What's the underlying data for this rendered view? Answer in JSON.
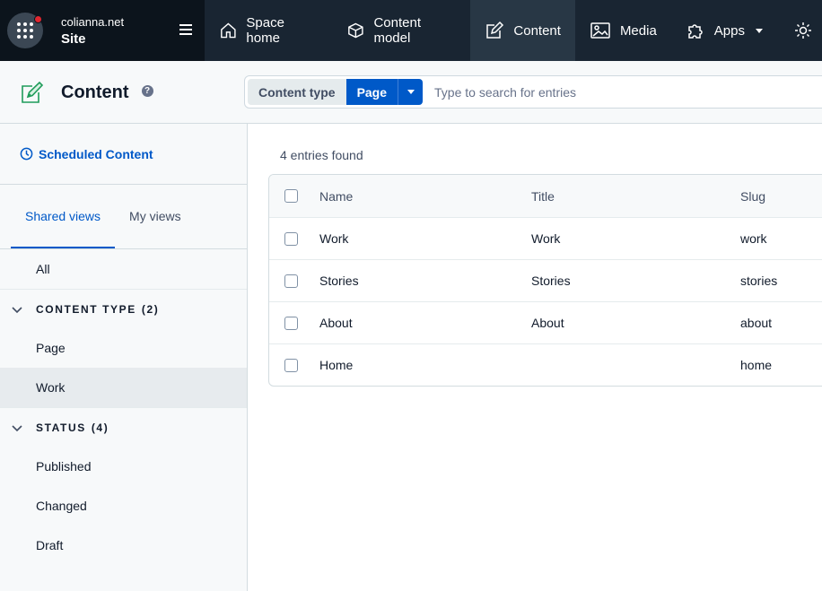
{
  "org": {
    "name": "colianna.net",
    "space": "Site"
  },
  "nav": {
    "items": [
      {
        "label": "Space home",
        "icon": "home-icon"
      },
      {
        "label": "Content model",
        "icon": "cube-icon"
      },
      {
        "label": "Content",
        "icon": "edit-icon",
        "active": true
      },
      {
        "label": "Media",
        "icon": "image-icon"
      },
      {
        "label": "Apps",
        "icon": "puzzle-icon"
      }
    ]
  },
  "header": {
    "title": "Content"
  },
  "search": {
    "filter_label": "Content type",
    "filter_value": "Page",
    "placeholder": "Type to search for entries",
    "value": ""
  },
  "sidebar": {
    "scheduled": "Scheduled Content",
    "tabs": [
      "Shared views",
      "My views"
    ],
    "all": "All",
    "groups": [
      {
        "label": "CONTENT TYPE",
        "count": "(2)",
        "items": [
          "Page",
          "Work"
        ]
      },
      {
        "label": "STATUS",
        "count": "(4)",
        "items": [
          "Published",
          "Changed",
          "Draft"
        ]
      }
    ]
  },
  "main": {
    "count_text": "4 entries found",
    "columns": [
      "Name",
      "Title",
      "Slug"
    ],
    "rows": [
      {
        "name": "Work",
        "title": "Work",
        "slug": "work"
      },
      {
        "name": "Stories",
        "title": "Stories",
        "slug": "stories"
      },
      {
        "name": "About",
        "title": "About",
        "slug": "about"
      },
      {
        "name": "Home",
        "title": "",
        "slug": "home"
      }
    ]
  },
  "colors": {
    "nav_bg": "#192532",
    "org_bg": "#0c141c",
    "accent": "#0059c8",
    "notification": "#e0262f"
  }
}
